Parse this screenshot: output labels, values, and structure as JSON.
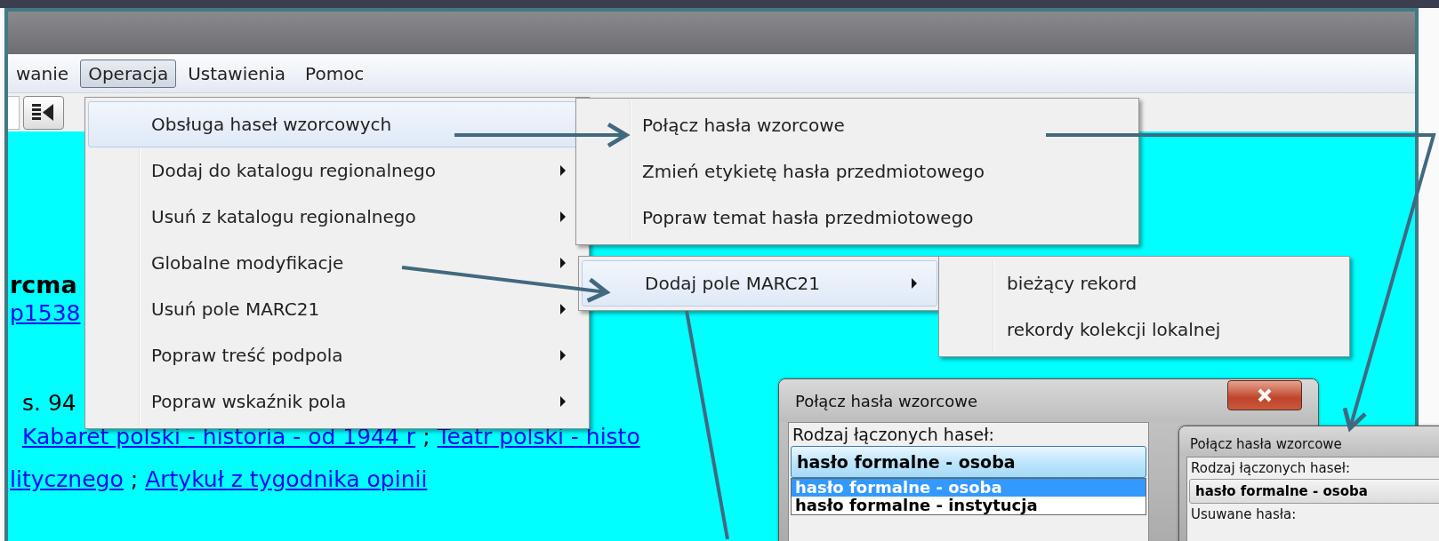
{
  "menubar": [
    {
      "label": "wanie",
      "selected": false
    },
    {
      "label": "Operacja",
      "selected": true
    },
    {
      "label": "Ustawienia",
      "selected": false
    },
    {
      "label": "Pomoc",
      "selected": false
    }
  ],
  "operation_menu": [
    {
      "label": "Obsługa haseł wzorcowych",
      "selected": true,
      "has_submenu": false
    },
    {
      "label": "Dodaj do katalogu regionalnego",
      "selected": false,
      "has_submenu": true
    },
    {
      "label": "Usuń z katalogu regionalnego",
      "selected": false,
      "has_submenu": true
    },
    {
      "label": "Globalne modyfikacje",
      "selected": false,
      "has_submenu": true
    },
    {
      "label": "Usuń pole MARC21",
      "selected": false,
      "has_submenu": true
    },
    {
      "label": "Popraw treść podpola",
      "selected": false,
      "has_submenu": true
    },
    {
      "label": "Popraw wskaźnik pola",
      "selected": false,
      "has_submenu": true
    }
  ],
  "authority_submenu": [
    {
      "label": "Połącz hasła wzorcowe",
      "selected": false,
      "has_submenu": false
    },
    {
      "label": "Zmień etykietę hasła przedmiotowego",
      "selected": false,
      "has_submenu": false
    },
    {
      "label": "Popraw temat hasła przedmiotowego",
      "selected": false,
      "has_submenu": false
    }
  ],
  "global_submenu": [
    {
      "label": "Dodaj pole MARC21",
      "selected": true,
      "has_submenu": true
    }
  ],
  "marc_submenu": [
    {
      "label": "bieżący rekord",
      "selected": false,
      "has_submenu": false
    },
    {
      "label": "rekordy kolekcji lokalnej",
      "selected": false,
      "has_submenu": false
    }
  ],
  "content": {
    "heading": "rcma",
    "id_link": "p1538",
    "pages": "s. 94",
    "lines": [
      [
        {
          "kind": "link",
          "text": "Kabaret polski - historia - od 1944 r"
        },
        {
          "kind": "text",
          "text": ";"
        },
        {
          "kind": "link",
          "text": "Teatr polski - histo"
        }
      ],
      [
        {
          "kind": "link",
          "text": "litycznego"
        },
        {
          "kind": "text",
          "text": ";"
        },
        {
          "kind": "link",
          "text": "Artykuł z tygodnika opinii"
        }
      ]
    ]
  },
  "dialogs": [
    {
      "title": "Połącz hasła wzorcowe",
      "close_button": true,
      "field_label": "Rodzaj łączonych haseł:",
      "combo_value": "hasło formalne - osoba",
      "options": [
        {
          "label": "hasło formalne - osoba",
          "selected": true
        },
        {
          "label": "hasło formalne - instytucja",
          "selected": false
        }
      ]
    },
    {
      "title": "Połącz hasła wzorcowe",
      "close_button": false,
      "field_label": "Rodzaj łączonych haseł:",
      "combo_value": "hasło formalne - osoba",
      "next_label": "Usuwane hasła:"
    }
  ]
}
